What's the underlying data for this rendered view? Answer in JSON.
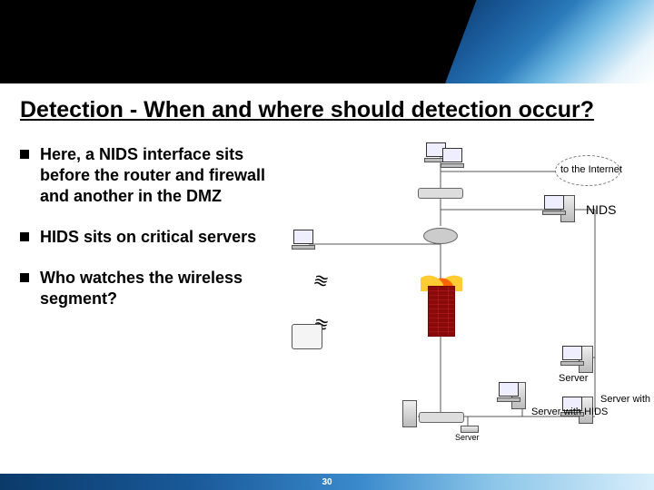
{
  "slide": {
    "title": "Detection - When and where should detection occur?",
    "bullets": [
      "Here, a NIDS interface sits before the router and firewall and another in the DMZ",
      "HIDS sits on critical servers",
      "Who watches the wireless segment?"
    ],
    "page_number": "30"
  },
  "diagram": {
    "labels": {
      "internet": "to the Internet",
      "nids": "NIDS",
      "server": "Server",
      "server_hids_1": "Server\nwith\nHIDS",
      "server_hids_2": "Server\nwith\nHIDS"
    }
  }
}
